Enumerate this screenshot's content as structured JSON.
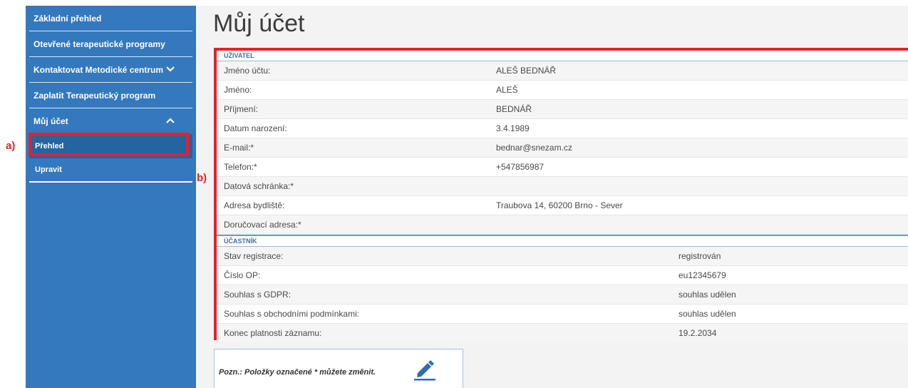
{
  "sidebar": {
    "items": [
      {
        "label": "Základní přehled"
      },
      {
        "label": "Otevřené terapeutické programy"
      },
      {
        "label": "Kontaktovat Metodické centrum"
      },
      {
        "label": "Zaplatit Terapeutický program"
      },
      {
        "label": "Můj účet"
      }
    ],
    "subitems": [
      {
        "label": "Přehled"
      },
      {
        "label": "Upravit"
      }
    ]
  },
  "annotations": {
    "a": "a)",
    "b": "b)"
  },
  "page": {
    "title": "Můj účet"
  },
  "user_section": {
    "heading": "UŽIVATEL",
    "rows": [
      {
        "label": "Jméno účtu:",
        "value": "ALEŠ BEDNÁŘ"
      },
      {
        "label": "Jméno:",
        "value": "ALEŠ"
      },
      {
        "label": "Příjmení:",
        "value": "BEDNÁŘ"
      },
      {
        "label": "Datum narození:",
        "value": "3.4.1989"
      },
      {
        "label": "E-mail:*",
        "value": "bednar@snezam.cz"
      },
      {
        "label": "Telefon:*",
        "value": "+547856987"
      },
      {
        "label": "Datová schránka:*",
        "value": ""
      },
      {
        "label": "Adresa bydliště:",
        "value": "Traubova 14, 60200 Brno - Sever"
      },
      {
        "label": "Doručovací adresa:*",
        "value": ""
      }
    ]
  },
  "participant_section": {
    "heading": "ÚČASTNÍK",
    "rows": [
      {
        "label": "Stav registrace:",
        "value": "registrován"
      },
      {
        "label": "Číslo OP:",
        "value": "eu12345679"
      },
      {
        "label": "Souhlas s GDPR:",
        "value": "souhlas udělen"
      },
      {
        "label": "Souhlas s obchodními podmínkami:",
        "value": "souhlas udělen"
      },
      {
        "label": "Konec platnosti záznamu:",
        "value": "19.2.2034"
      }
    ]
  },
  "note": {
    "text": "Pozn.: Položky označené * můžete změnit.",
    "icon": "pencil-icon"
  },
  "colors": {
    "sidebar": "#3478bd",
    "active": "#24649f",
    "highlight": "#e2232a"
  }
}
